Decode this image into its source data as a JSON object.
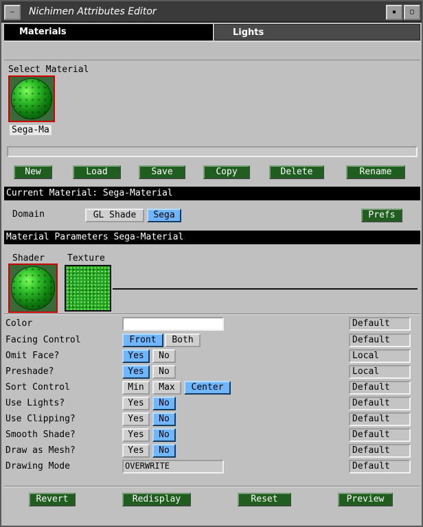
{
  "window": {
    "title": "Nichimen Attributes Editor",
    "menu_glyph": "—",
    "min_glyph": "▪",
    "max_glyph": "▢"
  },
  "tabs": [
    {
      "label": "Materials",
      "active": true
    },
    {
      "label": "Lights",
      "active": false
    }
  ],
  "select_material": {
    "heading": "Select Material",
    "items": [
      {
        "name": "Sega-Ma",
        "selected": true
      }
    ]
  },
  "material_buttons": [
    "New",
    "Load",
    "Save",
    "Copy",
    "Delete",
    "Rename"
  ],
  "current_material": {
    "header": "Current Material: Sega-Material",
    "domain_label": "Domain",
    "domains": [
      {
        "label": "GL Shade",
        "selected": false
      },
      {
        "label": "Sega",
        "selected": true
      }
    ],
    "prefs_label": "Prefs"
  },
  "parameters": {
    "header": "Material Parameters Sega-Material",
    "shader_label": "Shader",
    "texture_label": "Texture",
    "rows": [
      {
        "label": "Color",
        "kind": "color",
        "value": "",
        "scope": "Default"
      },
      {
        "label": "Facing Control",
        "kind": "options",
        "options": [
          {
            "label": "Front",
            "selected": true
          },
          {
            "label": "Both",
            "selected": false
          }
        ],
        "scope": "Default"
      },
      {
        "label": "Omit Face?",
        "kind": "options",
        "options": [
          {
            "label": "Yes",
            "selected": true
          },
          {
            "label": "No",
            "selected": false
          }
        ],
        "scope": "Local"
      },
      {
        "label": "Preshade?",
        "kind": "options",
        "options": [
          {
            "label": "Yes",
            "selected": true
          },
          {
            "label": "No",
            "selected": false
          }
        ],
        "scope": "Local"
      },
      {
        "label": "Sort Control",
        "kind": "options",
        "options": [
          {
            "label": "Min",
            "selected": false
          },
          {
            "label": "Max",
            "selected": false
          },
          {
            "label": "Center",
            "selected": true
          }
        ],
        "scope": "Default"
      },
      {
        "label": "Use Lights?",
        "kind": "options",
        "options": [
          {
            "label": "Yes",
            "selected": false
          },
          {
            "label": "No",
            "selected": true
          }
        ],
        "scope": "Default"
      },
      {
        "label": "Use Clipping?",
        "kind": "options",
        "options": [
          {
            "label": "Yes",
            "selected": false
          },
          {
            "label": "No",
            "selected": true
          }
        ],
        "scope": "Default"
      },
      {
        "label": "Smooth Shade?",
        "kind": "options",
        "options": [
          {
            "label": "Yes",
            "selected": false
          },
          {
            "label": "No",
            "selected": true
          }
        ],
        "scope": "Default"
      },
      {
        "label": "Draw as Mesh?",
        "kind": "options",
        "options": [
          {
            "label": "Yes",
            "selected": false
          },
          {
            "label": "No",
            "selected": true
          }
        ],
        "scope": "Default"
      },
      {
        "label": "Drawing Mode",
        "kind": "text",
        "value": "OVERWRITE",
        "scope": "Default"
      }
    ]
  },
  "footer_buttons": [
    "Revert",
    "Redisplay",
    "Reset",
    "Preview"
  ],
  "colors": {
    "button_green": "#1f5e1f",
    "selected_blue": "#6fb6ff",
    "selection_red": "#d00000"
  }
}
